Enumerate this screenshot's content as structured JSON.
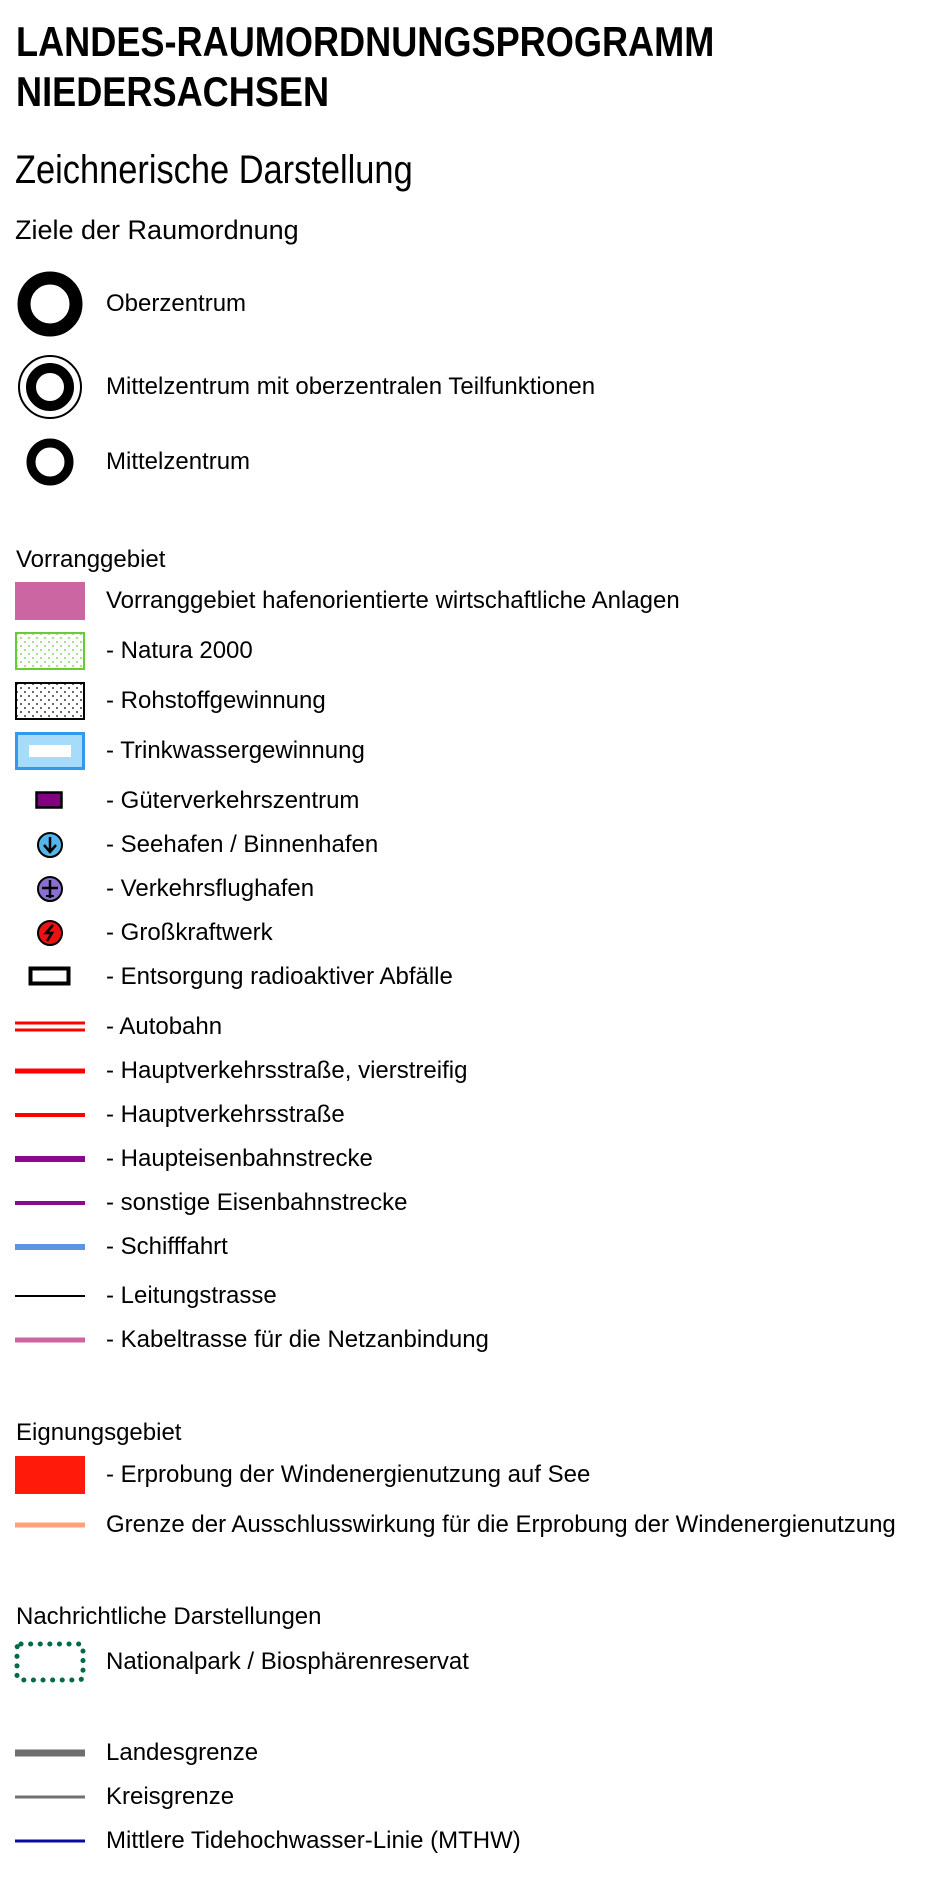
{
  "title_line1": "LANDES-RAUMORDNUNGSPROGRAMM",
  "title_line2": "NIEDERSACHSEN",
  "subtitle": "Zeichnerische Darstellung",
  "heading": "Ziele der Raumordnung",
  "centers": [
    {
      "label": "Oberzentrum",
      "icon": "oberzentrum-icon"
    },
    {
      "label": "Mittelzentrum mit oberzentralen Teilfunktionen",
      "icon": "mittelzentrum-teilfunktionen-icon"
    },
    {
      "label": "Mittelzentrum",
      "icon": "mittelzentrum-icon"
    }
  ],
  "vorrang": {
    "title": "Vorranggebiet",
    "items": [
      {
        "label": "Vorranggebiet hafenorientierte wirtschaftliche Anlagen",
        "color": "#cc66a2"
      },
      {
        "label": "- Natura 2000",
        "color": "#66cc33"
      },
      {
        "label": "- Rohstoffgewinnung",
        "color": "#000000"
      },
      {
        "label": "- Trinkwassergewinnung",
        "color": "#3399ee"
      },
      {
        "label": "- Güterverkehrszentrum",
        "color": "#800080"
      },
      {
        "label": "- Seehafen / Binnenhafen",
        "color": "#55b4ea"
      },
      {
        "label": "- Verkehrsflughafen",
        "color": "#8a6fd1"
      },
      {
        "label": "- Großkraftwerk",
        "color": "#ee1111"
      },
      {
        "label": "- Entsorgung radioaktiver Abfälle",
        "color": "#000000"
      },
      {
        "label": "- Autobahn",
        "color": "#ff0000"
      },
      {
        "label": "- Hauptverkehrsstraße, vierstreifig",
        "color": "#ff0000"
      },
      {
        "label": "- Hauptverkehrsstraße",
        "color": "#ff0000"
      },
      {
        "label": "- Haupteisenbahnstrecke",
        "color": "#8b0a8b"
      },
      {
        "label": "- sonstige Eisenbahnstrecke",
        "color": "#8b0a8b"
      },
      {
        "label": "- Schifffahrt",
        "color": "#5b95e0"
      },
      {
        "label": "- Leitungstrasse",
        "color": "#000000"
      },
      {
        "label": "- Kabeltrasse für die Netzanbindung",
        "color": "#cc66a2"
      }
    ]
  },
  "eignung": {
    "title": "Eignungsgebiet",
    "items": [
      {
        "label": "- Erprobung der Windenergienutzung auf See",
        "color": "#ff1a0a"
      },
      {
        "label": "Grenze der Ausschlusswirkung für die Erprobung der Windenergienutzung",
        "color": "#ffa07a"
      }
    ]
  },
  "nachrichtlich": {
    "title": "Nachrichtliche Darstellungen",
    "items": [
      {
        "label": "Nationalpark / Biosphärenreservat",
        "color": "#006a4a"
      },
      {
        "label": "Landesgrenze",
        "color": "#6e6e6e"
      },
      {
        "label": "Kreisgrenze",
        "color": "#707070"
      },
      {
        "label": "Mittlere Tidehochwasser-Linie (MTHW)",
        "color": "#0a0aa0"
      }
    ]
  }
}
